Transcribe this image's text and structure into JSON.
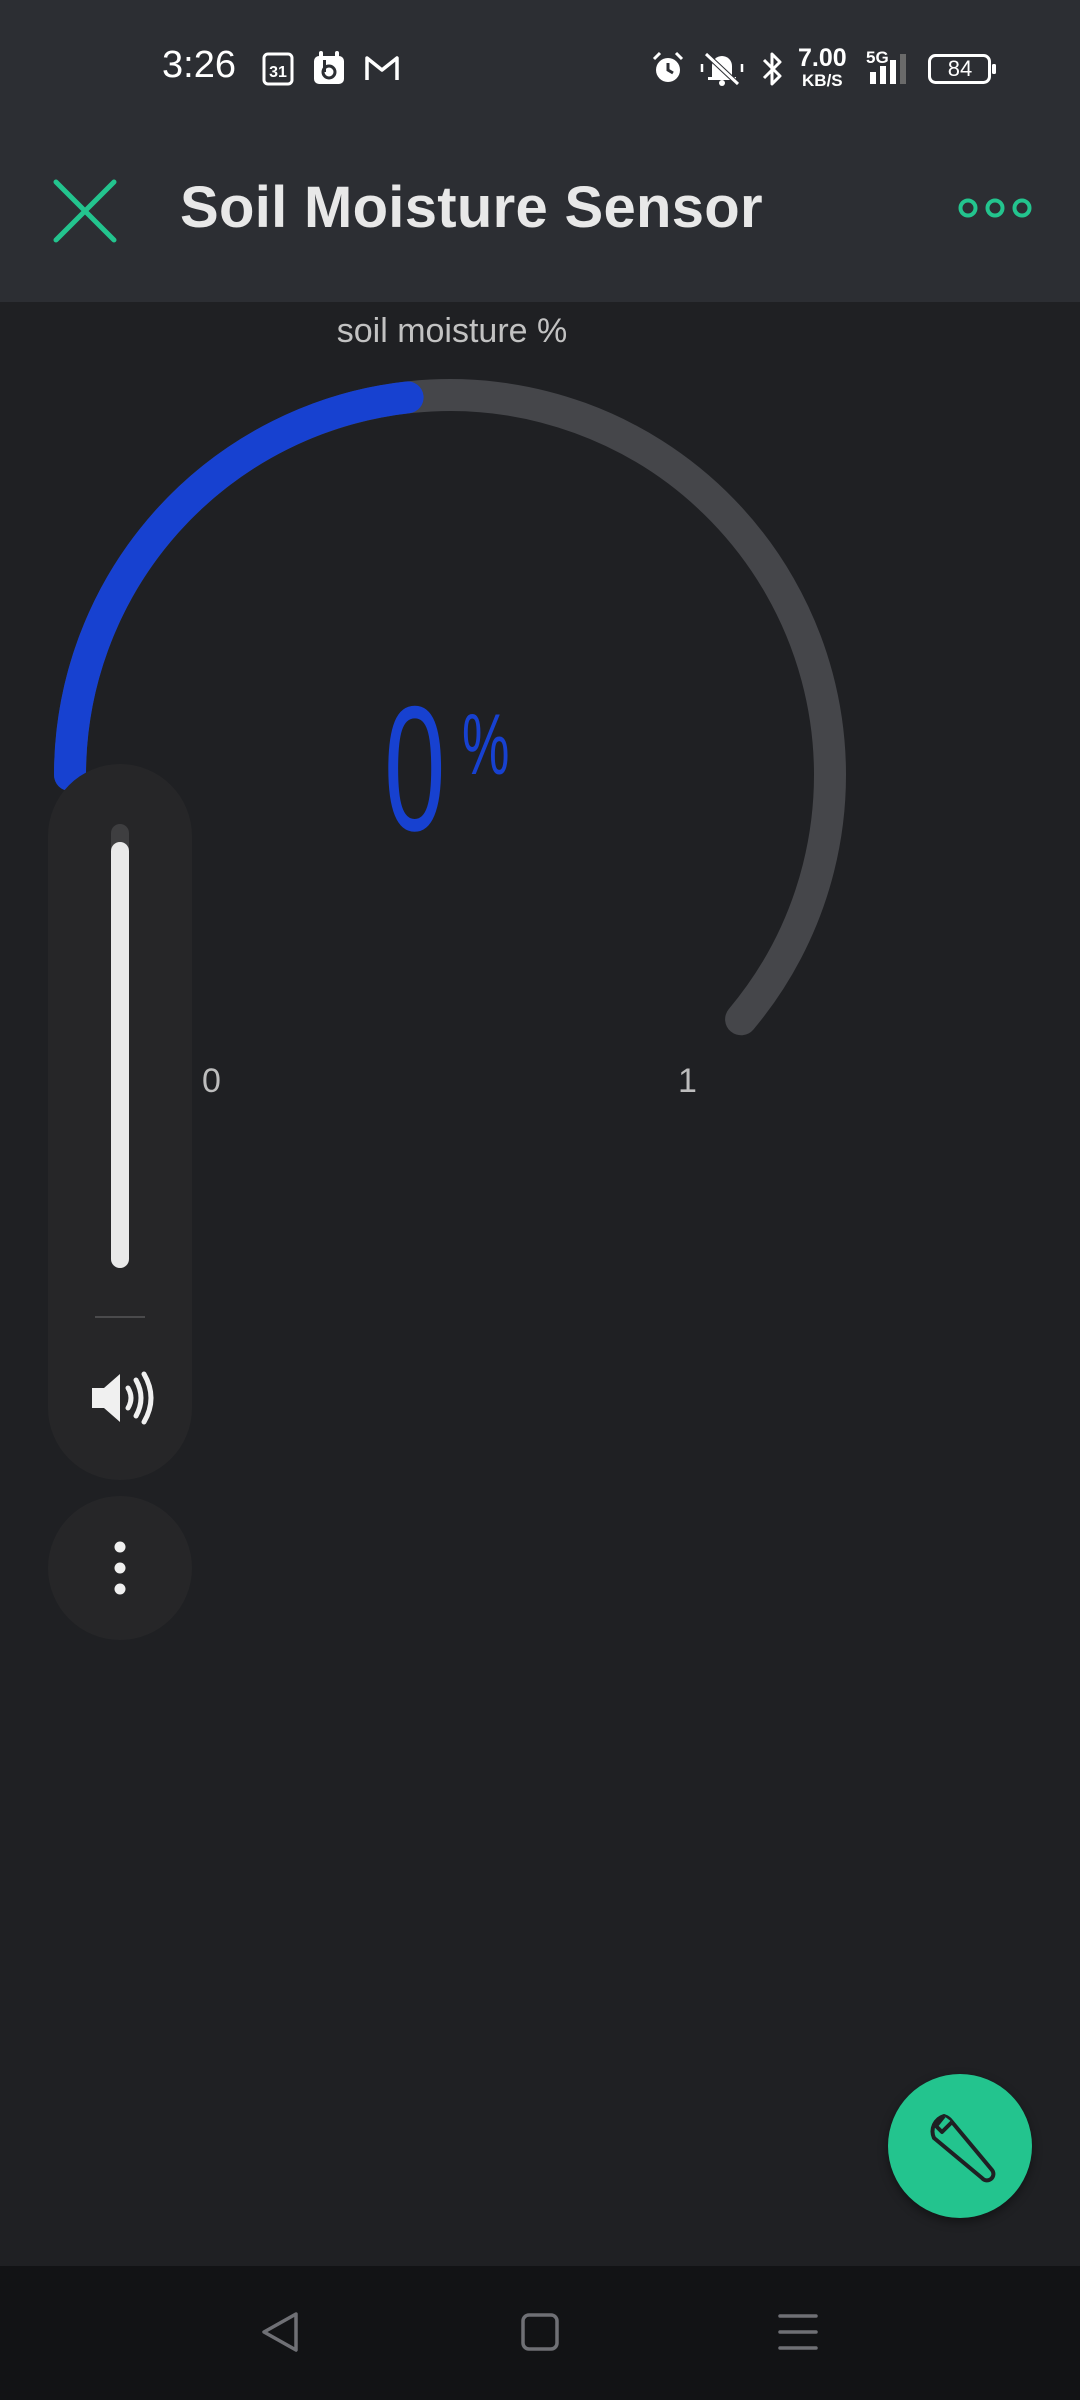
{
  "status_bar": {
    "time": "3:26",
    "calendar_day": "31",
    "net_speed_value": "7.00",
    "net_speed_unit": "KB/S",
    "network_type": "5G",
    "battery_level": "84"
  },
  "header": {
    "title": "Soil Moisture Sensor"
  },
  "gauge": {
    "label": "soil moisture %",
    "value": "0",
    "unit": "%",
    "min": "0",
    "max": "1",
    "fill_fraction": 0.38,
    "colors": {
      "fill": "#1741d0",
      "track": "#45464a"
    }
  },
  "volume_panel": {
    "level_fraction": 0.96,
    "icons": [
      "speaker-icon",
      "more-vertical-icon"
    ]
  },
  "colors": {
    "accent": "#23c48e",
    "header_bg": "#2c2e33",
    "background": "#1f2023"
  }
}
